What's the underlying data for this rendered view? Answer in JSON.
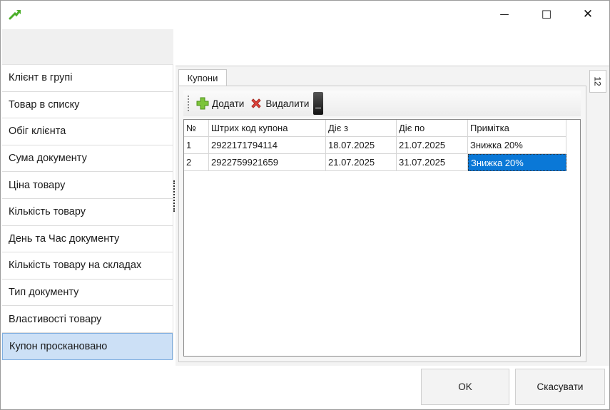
{
  "window": {
    "close_glyph": "✕",
    "maximize_glyph": "☐",
    "minimize_glyph": "—"
  },
  "sidebar": {
    "items": [
      {
        "label": "Клієнт в групі"
      },
      {
        "label": "Товар в списку"
      },
      {
        "label": "Обіг клієнта"
      },
      {
        "label": "Сума документу"
      },
      {
        "label": "Ціна товару"
      },
      {
        "label": "Кількість товару"
      },
      {
        "label": "День та Час документу"
      },
      {
        "label": "Кількість товару на складах"
      },
      {
        "label": "Тип документу"
      },
      {
        "label": "Властивості товару"
      },
      {
        "label": "Купон проскановано",
        "selected": true
      }
    ]
  },
  "tabs": {
    "main_label": "Купони",
    "side_label": "12"
  },
  "toolbar": {
    "add_label": "Додати",
    "delete_label": "Видалити"
  },
  "grid": {
    "columns": [
      "№",
      "Штрих код купона",
      "Діє з",
      "Діє по",
      "Примітка"
    ],
    "rows": [
      [
        "1",
        "2922171794114",
        "18.07.2025",
        "21.07.2025",
        "Знижка 20%"
      ],
      [
        "2",
        "2922759921659",
        "21.07.2025",
        "31.07.2025",
        "Знижка 20%"
      ]
    ],
    "active_cell": {
      "row": 1,
      "col": 4
    }
  },
  "buttons": {
    "ok_label": "OK",
    "cancel_label": "Скасувати"
  },
  "colors": {
    "accent": "#0a78d7",
    "selection": "#cce0f6",
    "add_icon": "#7cc43a",
    "delete_icon": "#e0433b",
    "app_icon": "#4caf2a"
  }
}
